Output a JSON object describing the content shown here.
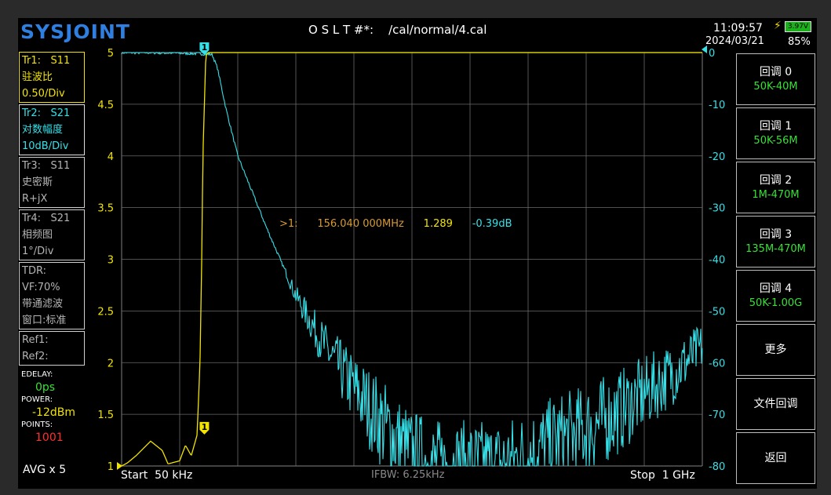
{
  "header": {
    "logo": "SYSJOINT",
    "cal_label": "O S L T #*:",
    "cal_path": "/cal/normal/4.cal",
    "time": "11:09:57",
    "date": "2024/03/21",
    "battery_voltage": "3.97V",
    "battery_percent": "85%"
  },
  "traces": [
    {
      "name": "Tr1:",
      "param": "S11",
      "format": "驻波比",
      "scale": "0.50/Div",
      "color": "#f2e400"
    },
    {
      "name": "Tr2:",
      "param": "S21",
      "format": "对数幅度",
      "scale": "10dB/Div",
      "color": "#35e0e8"
    },
    {
      "name": "Tr3:",
      "param": "S11",
      "format": "史密斯",
      "scale": "R+jX",
      "color": "#b4b4b4"
    },
    {
      "name": "Tr4:",
      "param": "S21",
      "format": "相频图",
      "scale": "1°/Div",
      "color": "#b4b4b4"
    }
  ],
  "tdr": {
    "title": "TDR:",
    "vf": "VF:70%",
    "mode": "带通滤波",
    "window": "窗口:标准"
  },
  "refs": [
    "Ref1:",
    "Ref2:"
  ],
  "side_info": {
    "edelay_label": "EDELAY:",
    "edelay_value": "0ps",
    "power_label": "POWER:",
    "power_value": "-12dBm",
    "points_label": "POINTS:",
    "points_value": "1001",
    "avg": "AVG x 5"
  },
  "axes": {
    "left_ticks": [
      "5",
      "4.5",
      "4",
      "3.5",
      "3",
      "2.5",
      "2",
      "1.5",
      "1"
    ],
    "right_ticks": [
      "0",
      "-10",
      "-20",
      "-30",
      "-40",
      "-50",
      "-60",
      "-70",
      "-80"
    ],
    "start": "Start  50 kHz",
    "stop": "Stop  1 GHz",
    "ifbw": "IFBW: 6.25kHz"
  },
  "marker": {
    "label": "1",
    "readout_id": ">1:",
    "frequency": "156.040 000MHz",
    "swr": "1.289",
    "db": "-0.39dB"
  },
  "menu": [
    {
      "title": "回调 0",
      "sub": "50K-40M"
    },
    {
      "title": "回调 1",
      "sub": "50K-56M"
    },
    {
      "title": "回调 2",
      "sub": "1M-470M"
    },
    {
      "title": "回调 3",
      "sub": "135M-470M"
    },
    {
      "title": "回调 4",
      "sub": "50K-1.00G"
    },
    {
      "title": "更多",
      "sub": ""
    },
    {
      "title": "文件回调",
      "sub": ""
    },
    {
      "title": "返回",
      "sub": ""
    }
  ],
  "chart_data": {
    "type": "line",
    "x_range_mhz": [
      0.05,
      1000
    ],
    "series": [
      {
        "name": "Tr1: S11",
        "axis": "left",
        "ylim": [
          1,
          5
        ],
        "x_mhz": [
          0.05,
          10,
          25,
          50,
          70,
          80,
          100,
          110,
          120,
          130,
          135,
          138,
          140,
          145,
          150,
          156,
          160,
          200,
          400,
          600,
          800,
          1000
        ],
        "y": [
          1.0,
          1.03,
          1.1,
          1.24,
          1.15,
          1.02,
          1.05,
          1.2,
          1.1,
          1.3,
          2.0,
          3.0,
          4.0,
          4.97,
          5.0,
          5.0,
          5.0,
          5.0,
          5.0,
          5.0,
          5.0,
          5.0
        ]
      },
      {
        "name": "Tr2: S21",
        "axis": "right",
        "ylim": [
          -80,
          0
        ],
        "x_mhz": [
          0.05,
          50,
          100,
          130,
          150,
          156,
          165,
          180,
          200,
          250,
          300,
          350,
          400,
          450,
          500,
          550,
          600,
          650,
          700,
          750,
          800,
          850,
          900,
          950,
          1000
        ],
        "y": [
          0,
          0,
          -0.1,
          -0.2,
          -0.3,
          -0.39,
          -3,
          -11,
          -20,
          -34,
          -47,
          -57,
          -65,
          -72,
          -78,
          -80,
          -80,
          -80,
          -78,
          -75,
          -73,
          -70,
          -66,
          -62,
          -57
        ]
      }
    ]
  }
}
